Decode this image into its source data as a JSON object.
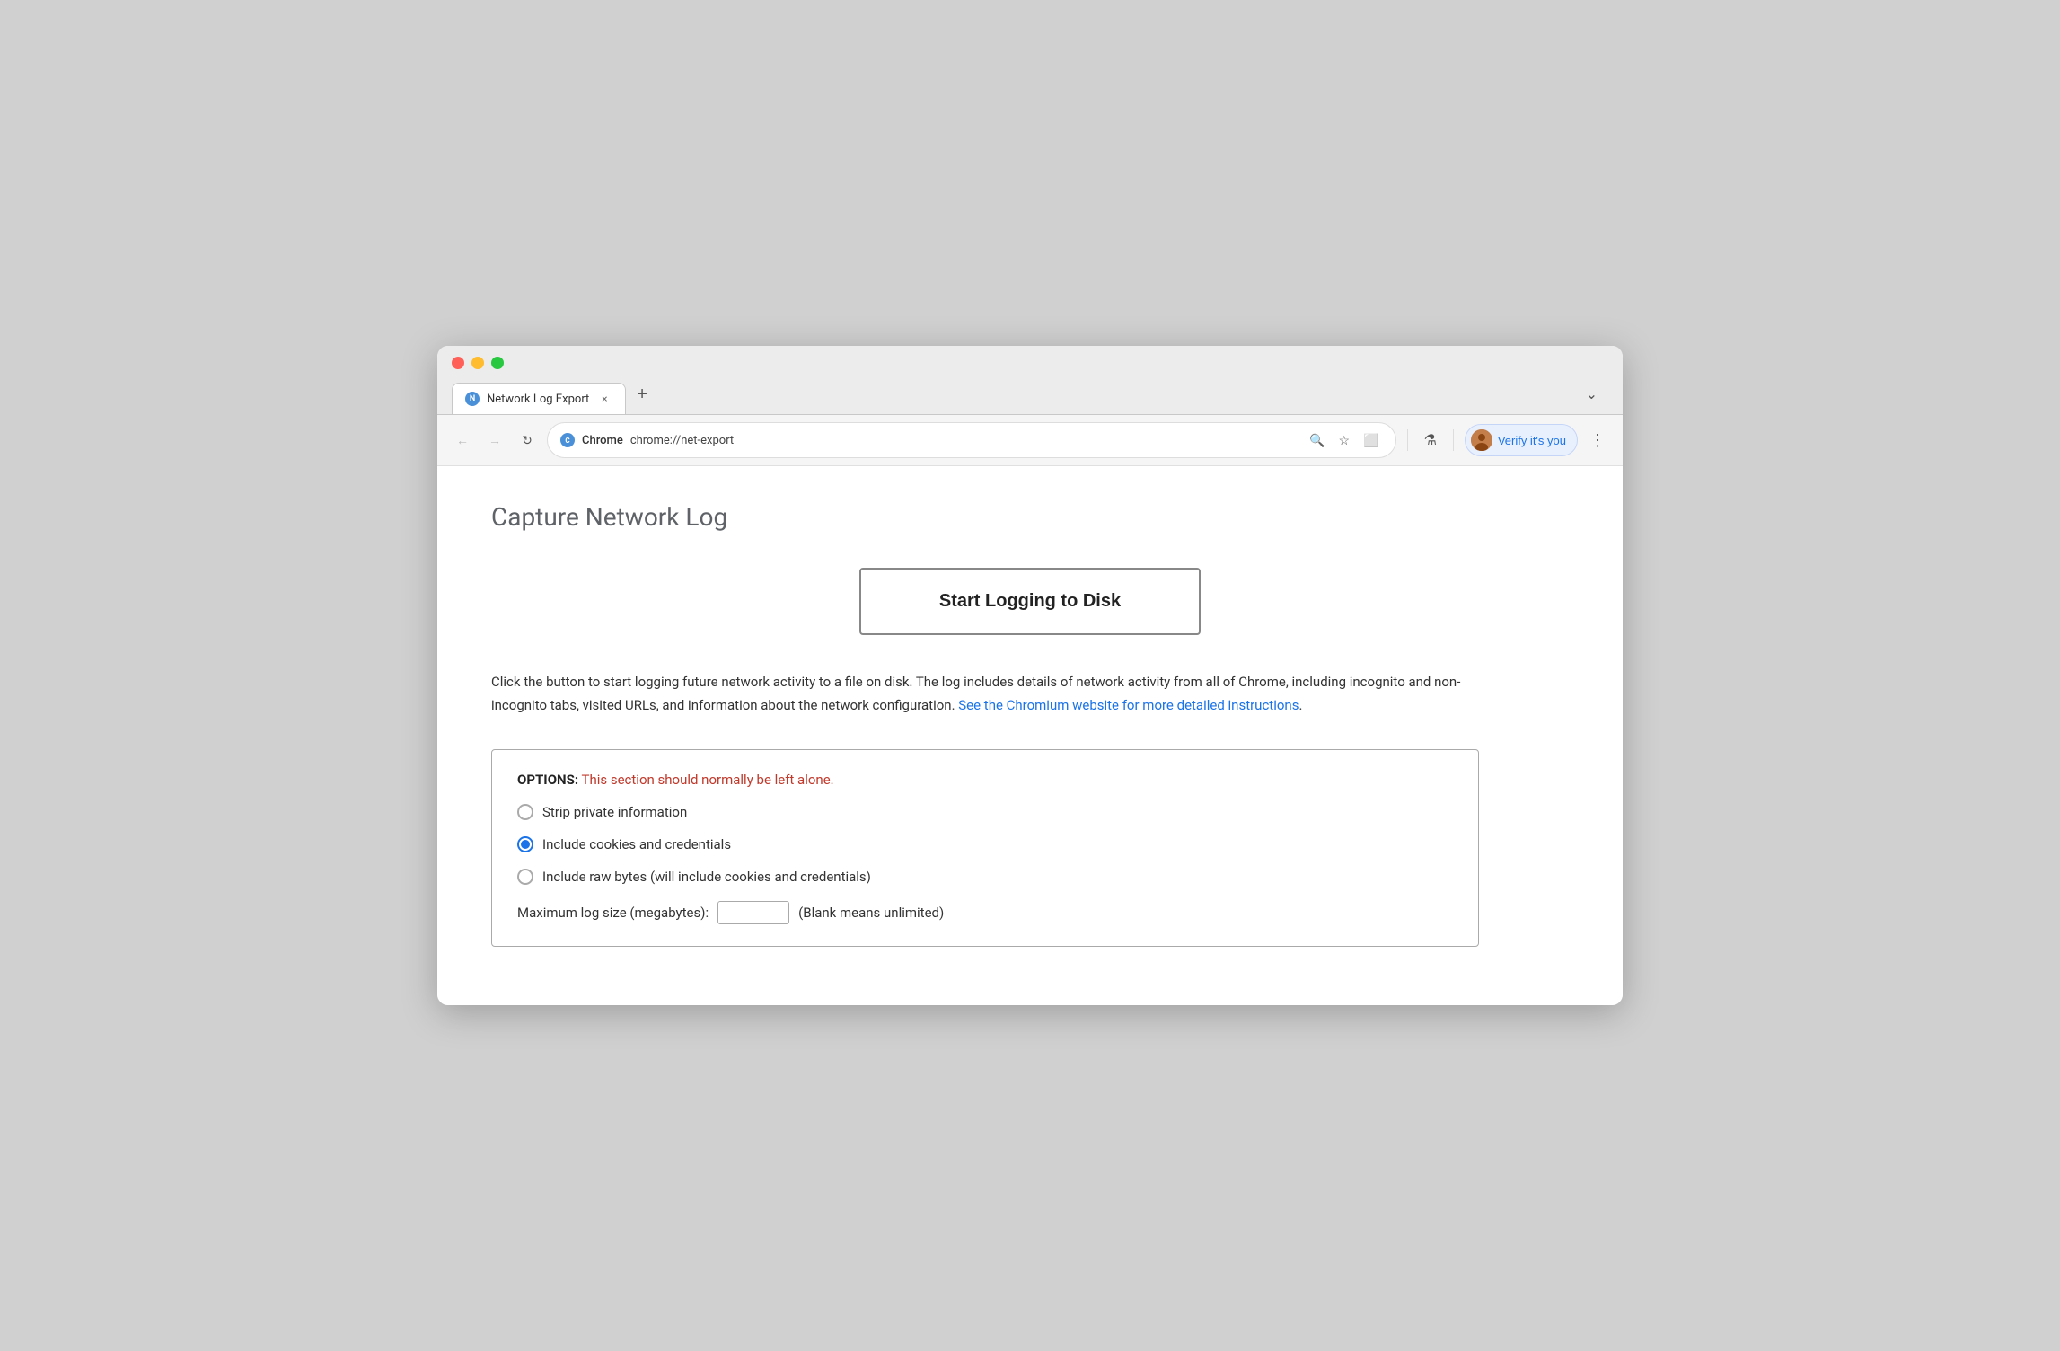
{
  "browser": {
    "tab": {
      "favicon_label": "N",
      "title": "Network Log Export",
      "close_label": "×",
      "new_tab_label": "+",
      "dropdown_label": "⌄"
    },
    "nav": {
      "back_label": "←",
      "forward_label": "→",
      "reload_label": "↻",
      "address_favicon_label": "C",
      "chrome_badge": "Chrome",
      "url": "chrome://net-export",
      "search_icon_label": "🔍",
      "bookmark_icon_label": "☆",
      "extension_icon_label": "⬜",
      "lab_icon_label": "⚗",
      "verify_label": "Verify it's you",
      "more_label": "⋮"
    }
  },
  "page": {
    "title": "Capture Network Log",
    "start_button_label": "Start Logging to Disk",
    "description_part1": "Click the button to start logging future network activity to a file on disk. The log includes details of network activity from all of Chrome, including incognito and non-incognito tabs, visited URLs, and information about the network configuration. ",
    "description_link": "See the Chromium website for more detailed instructions",
    "description_part2": ".",
    "options": {
      "header_bold": "OPTIONS:",
      "header_warning": " This section should normally be left alone.",
      "radio1_label": "Strip private information",
      "radio2_label": "Include cookies and credentials",
      "radio3_label": "Include raw bytes (will include cookies and credentials)",
      "max_log_label": "Maximum log size (megabytes):",
      "max_log_hint": "(Blank means unlimited)",
      "max_log_value": ""
    }
  }
}
